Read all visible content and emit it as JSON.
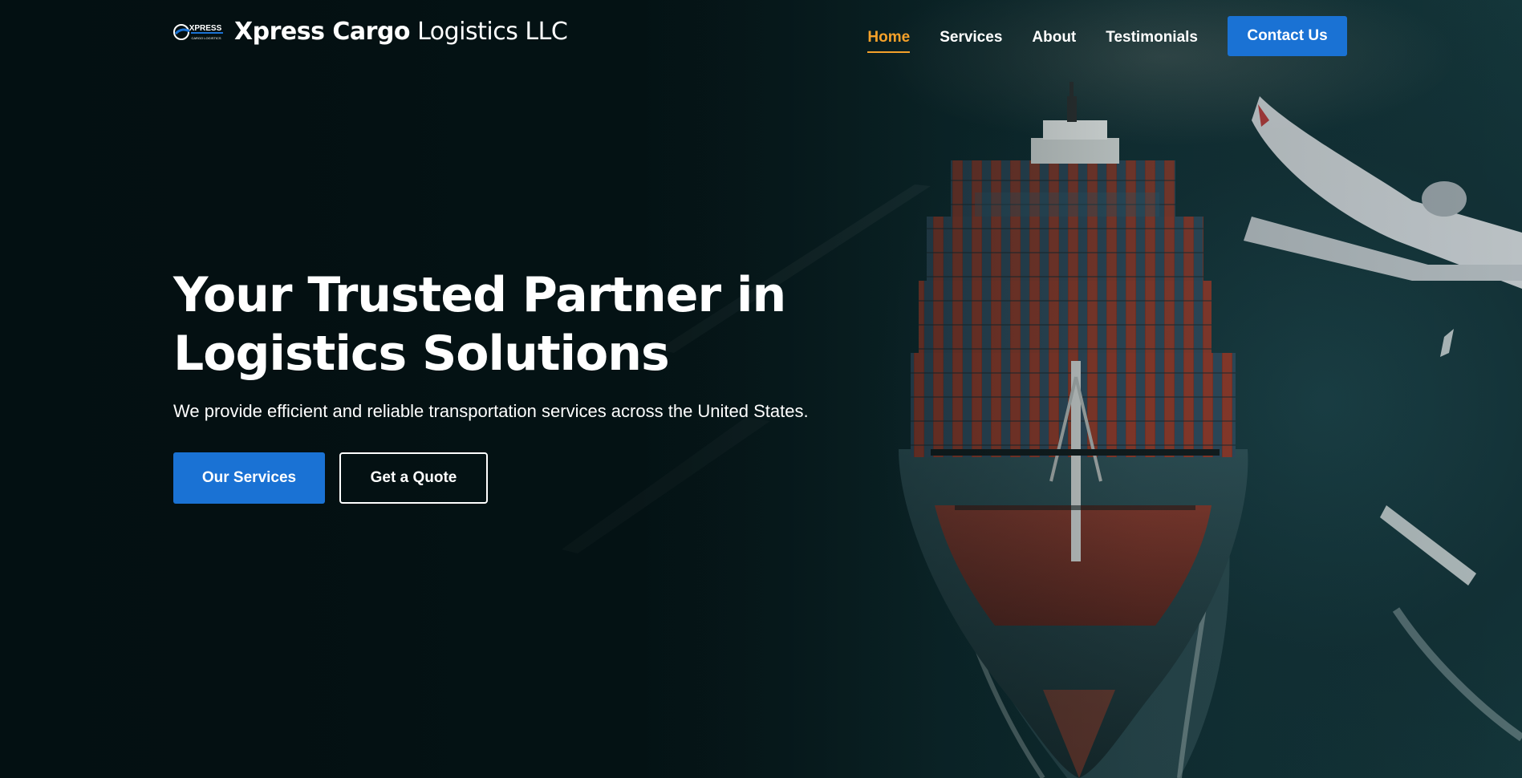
{
  "brand": {
    "name_bold": "Xpress Cargo",
    "name_light": " Logistics LLC",
    "logo_icon": "xpress-cargo-logo-icon",
    "logo_text": "XPRESS",
    "logo_subtext": "CARGO LOGISTICS"
  },
  "nav": {
    "items": [
      {
        "label": "Home",
        "active": true
      },
      {
        "label": "Services",
        "active": false
      },
      {
        "label": "About",
        "active": false
      },
      {
        "label": "Testimonials",
        "active": false
      }
    ],
    "contact_label": "Contact Us"
  },
  "hero": {
    "title_line1": "Your Trusted Partner in",
    "title_line2": "Logistics Solutions",
    "subtitle": "We provide efficient and reliable transportation services across the United States.",
    "primary_button": "Our Services",
    "secondary_button": "Get a Quote",
    "background_image": "container-ship-and-airplane-over-ocean"
  },
  "colors": {
    "accent_blue": "#1a72d4",
    "active_nav": "#f5a12a",
    "text": "#ffffff",
    "background": "#061518"
  }
}
